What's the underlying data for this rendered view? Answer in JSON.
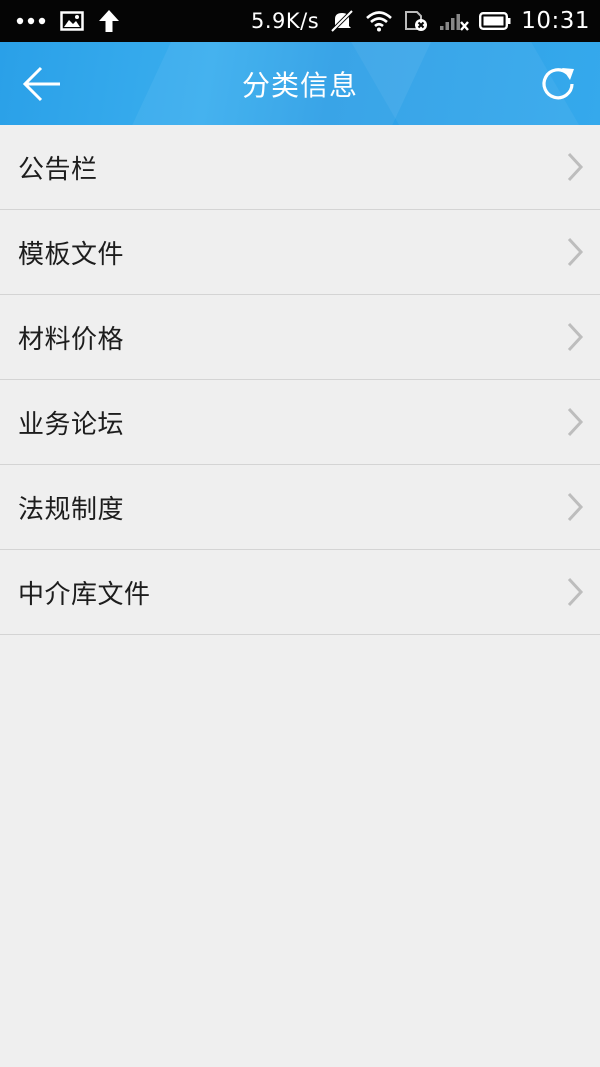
{
  "status_bar": {
    "network_speed": "5.9K/s",
    "time": "10:31",
    "icons": [
      "more-dots-icon",
      "image-notification-icon",
      "upload-arrow-icon",
      "muted-icon",
      "wifi-icon",
      "sim-card-icon",
      "signal-icon",
      "battery-icon"
    ]
  },
  "header": {
    "title": "分类信息",
    "back_icon": "back-arrow-icon",
    "refresh_icon": "refresh-icon",
    "accent_color": "#2aa0e8"
  },
  "categories": [
    {
      "label": "公告栏"
    },
    {
      "label": "模板文件"
    },
    {
      "label": "材料价格"
    },
    {
      "label": "业务论坛"
    },
    {
      "label": "法规制度"
    },
    {
      "label": "中介库文件"
    }
  ]
}
